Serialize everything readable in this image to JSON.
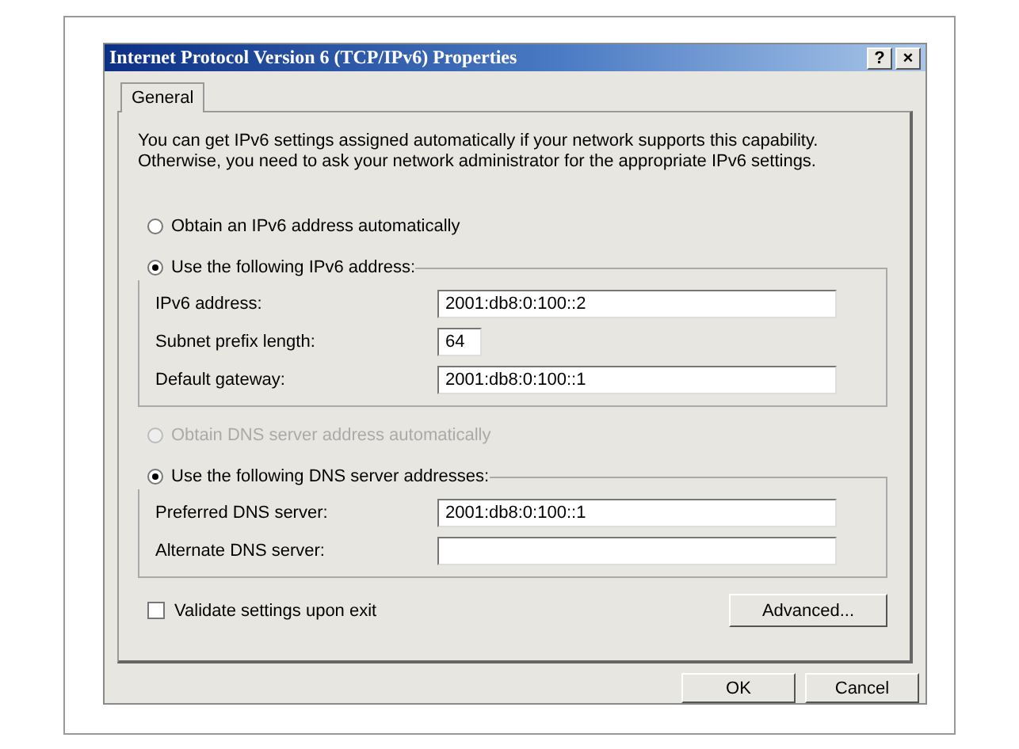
{
  "window": {
    "title": "Internet Protocol Version 6 (TCP/IPv6) Properties",
    "help_button": "?",
    "close_button": "×"
  },
  "tabs": [
    {
      "label": "General",
      "selected": true
    }
  ],
  "description": "You can get IPv6 settings assigned automatically if your network supports this capability.\nOtherwise, you need to ask your network administrator for the appropriate IPv6 settings.",
  "sections": [
    {
      "auto_option": {
        "label": "Obtain an IPv6 address automatically",
        "selected": false,
        "disabled": false
      },
      "manual_option": {
        "label": "Use the following IPv6 address:",
        "selected": true,
        "disabled": false
      },
      "fields": [
        {
          "label": "IPv6 address:",
          "value": "2001:db8:0:100::2",
          "kind": "wide"
        },
        {
          "label": "Subnet prefix length:",
          "value": "64",
          "kind": "short"
        },
        {
          "label": "Default gateway:",
          "value": "2001:db8:0:100::1",
          "kind": "wide"
        }
      ]
    },
    {
      "auto_option": {
        "label": "Obtain DNS server address automatically",
        "selected": false,
        "disabled": true
      },
      "manual_option": {
        "label": "Use the following DNS server addresses:",
        "selected": true,
        "disabled": false
      },
      "fields": [
        {
          "label": "Preferred DNS server:",
          "value": "2001:db8:0:100::1",
          "kind": "wide"
        },
        {
          "label": "Alternate DNS server:",
          "kind": "wide"
        }
      ]
    }
  ],
  "validate": {
    "label": "Validate settings upon exit",
    "checked": false
  },
  "advanced_button": "Advanced...",
  "buttons": [
    "OK",
    "Cancel"
  ]
}
